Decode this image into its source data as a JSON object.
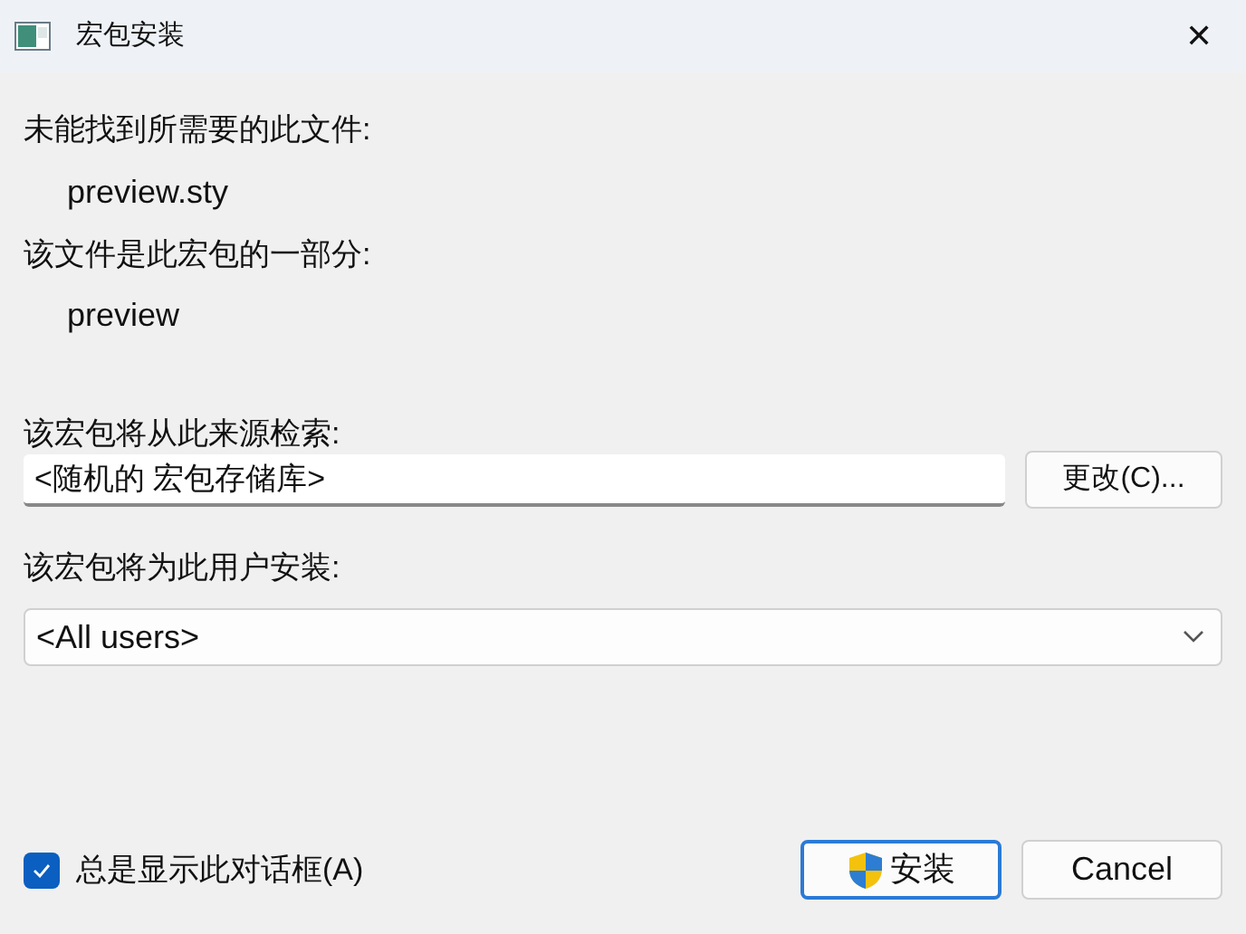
{
  "window": {
    "title": "宏包安装",
    "close": "✕"
  },
  "missing_label": "未能找到所需要的此文件:",
  "missing_file": "preview.sty",
  "package_label": "该文件是此宏包的一部分:",
  "package_name": "preview",
  "source_label": "该宏包将从此来源检索:",
  "source_field": {
    "value": "<随机的 宏包存储库>"
  },
  "change_button": "更改(C)...",
  "user_label": "该宏包将为此用户安装:",
  "user_select": {
    "value": "<All users>"
  },
  "always_show": {
    "label": "总是显示此对话框(A)",
    "checked": true
  },
  "buttons": [
    {
      "kind": "install",
      "label": "安装",
      "default": true
    },
    {
      "kind": "cancel",
      "label": "Cancel",
      "default": false
    }
  ]
}
